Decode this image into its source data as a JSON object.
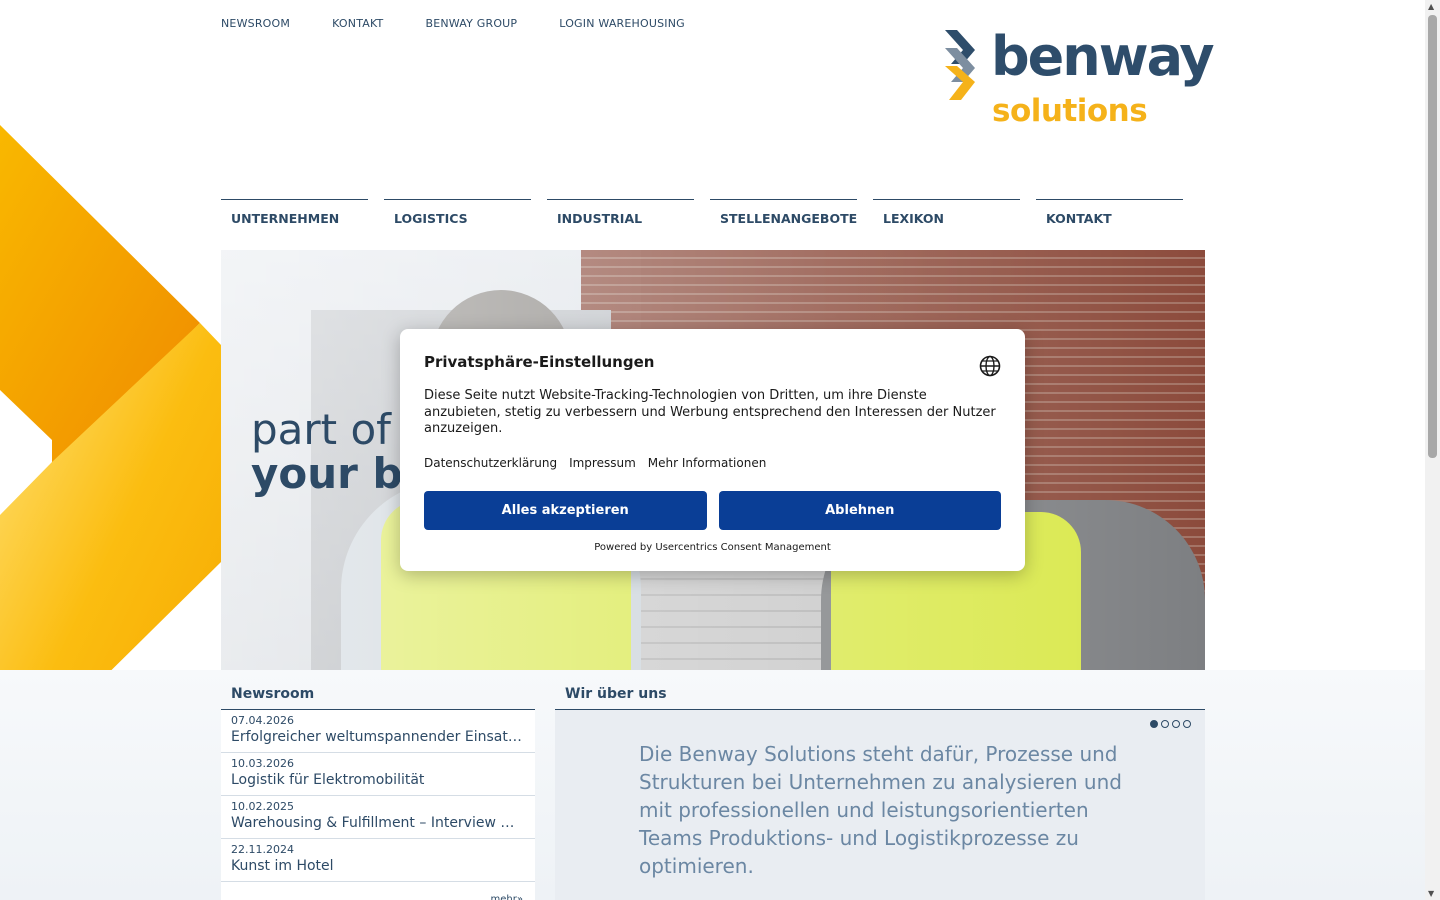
{
  "top_nav": [
    "NEWSROOM",
    "KONTAKT",
    "BENWAY GROUP",
    "LOGIN WAREHOUSING"
  ],
  "logo": {
    "line1": "benway",
    "line2": "solutions"
  },
  "main_nav": [
    "UNTERNEHMEN",
    "LOGISTICS",
    "INDUSTRIAL",
    "STELLENANGEBOTE",
    "LEXIKON",
    "KONTAKT"
  ],
  "hero": {
    "line1": "part of",
    "line2": "your bu"
  },
  "newsroom": {
    "heading": "Newsroom",
    "items": [
      {
        "date": "07.04.2026",
        "title": "Erfolgreicher weltumspannender Einsatz für…"
      },
      {
        "date": "10.03.2026",
        "title": "Logistik für Elektromobilität"
      },
      {
        "date": "10.02.2025",
        "title": "Warehousing & Fulfillment – Interview mit Ni…"
      },
      {
        "date": "22.11.2024",
        "title": "Kunst im Hotel"
      }
    ],
    "more": "mehr»"
  },
  "about": {
    "heading": "Wir über uns",
    "text": "Die Benway Solutions steht dafür, Prozesse und Strukturen bei Unternehmen zu analysieren und mit professionellen und leistungsorientierten Teams Produktions- und Logistikprozesse zu optimieren.",
    "slides_total": 4,
    "slide_active": 1
  },
  "consent": {
    "title": "Privatsphäre-Einstellungen",
    "description": "Diese Seite nutzt Website-Tracking-Technologien von Dritten, um ihre Dienste anzubieten, stetig zu verbessern und Werbung entsprechend den Interessen der Nutzer anzuzeigen.",
    "links": [
      "Datenschutzerklärung",
      "Impressum",
      "Mehr Informationen"
    ],
    "accept_label": "Alles akzeptieren",
    "decline_label": "Ablehnen",
    "powered_by": "Powered by Usercentrics Consent Management",
    "language_icon": "globe-icon"
  },
  "colors": {
    "brand_navy": "#2e4d6b",
    "brand_yellow": "#f5b21a",
    "consent_button": "#0a3e96"
  }
}
